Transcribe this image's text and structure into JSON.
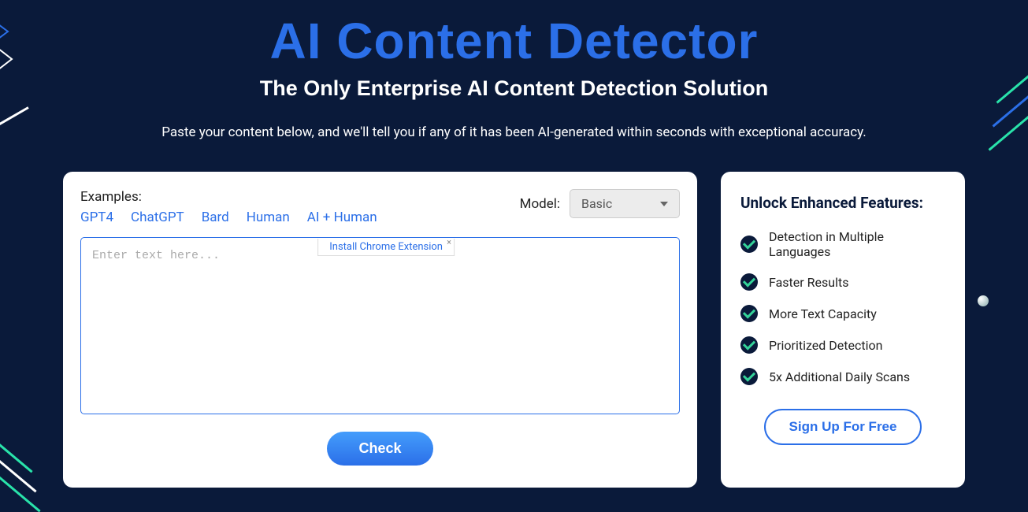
{
  "header": {
    "title": "AI Content Detector",
    "subtitle": "The Only Enterprise AI Content Detection Solution",
    "description": "Paste your content below, and we'll tell you if any of it has been AI-generated within seconds with exceptional accuracy."
  },
  "main": {
    "examples_label": "Examples:",
    "examples": [
      "GPT4",
      "ChatGPT",
      "Bard",
      "Human",
      "AI + Human"
    ],
    "model_label": "Model:",
    "model_selected": "Basic",
    "textarea_placeholder": "Enter text here...",
    "chrome_extension_label": "Install Chrome Extension",
    "check_button_label": "Check"
  },
  "sidebar": {
    "title": "Unlock Enhanced Features:",
    "features": [
      "Detection in Multiple Languages",
      "Faster Results",
      "More Text Capacity",
      "Prioritized Detection",
      "5x Additional Daily Scans"
    ],
    "signup_label": "Sign Up For Free"
  }
}
